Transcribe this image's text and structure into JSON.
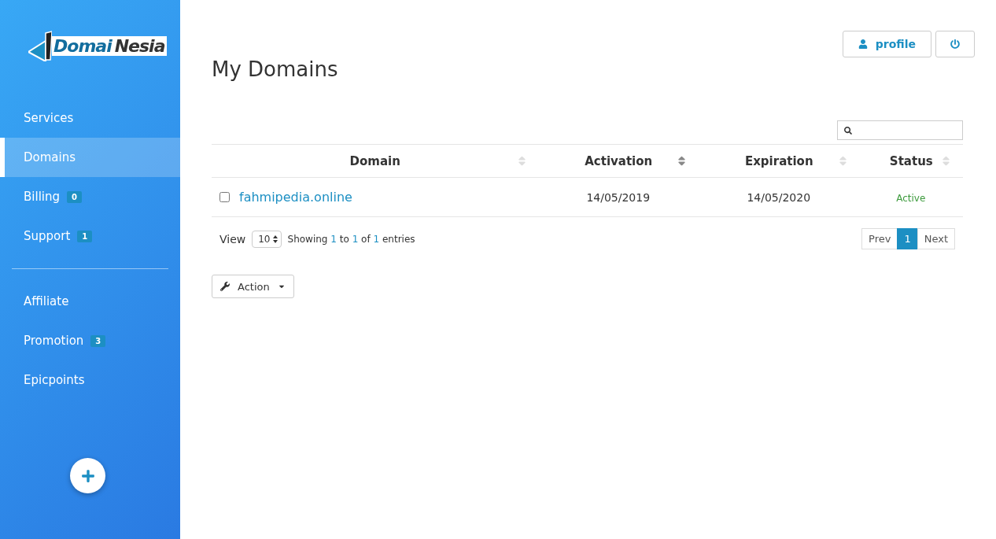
{
  "logo": {
    "parts": [
      "Domai",
      "Nesia"
    ]
  },
  "sidebar": {
    "groups": [
      {
        "items": [
          {
            "label": "Services",
            "selected": false
          },
          {
            "label": "Domains",
            "selected": true
          },
          {
            "label": "Billing",
            "selected": false,
            "badge": "0"
          },
          {
            "label": "Support",
            "selected": false,
            "badge": "1"
          }
        ]
      },
      {
        "items": [
          {
            "label": "Affiliate",
            "selected": false
          },
          {
            "label": "Promotion",
            "selected": false,
            "badge": "3"
          },
          {
            "label": "Epicpoints",
            "selected": false
          }
        ]
      }
    ]
  },
  "header": {
    "profile_button": "profile"
  },
  "page_title": "My Domains",
  "table": {
    "columns": [
      {
        "label": "Domain",
        "sorted": false
      },
      {
        "label": "Activation",
        "sorted": true
      },
      {
        "label": "Expiration",
        "sorted": false
      },
      {
        "label": "Status",
        "sorted": false
      }
    ],
    "rows": [
      {
        "checked": false,
        "domain": "fahmipedia.online",
        "activation": "14/05/2019",
        "expiration": "14/05/2020",
        "status": "Active",
        "color": "#3c9a3c"
      }
    ]
  },
  "footer": {
    "view_label": "View",
    "page_size": "10",
    "info": [
      "Showing",
      "1",
      "to",
      "1",
      "of",
      "1",
      "entries"
    ],
    "pagination": [
      {
        "label": "Prev",
        "selected": false
      },
      {
        "label": "1",
        "selected": true
      },
      {
        "label": "Next",
        "selected": false
      }
    ]
  },
  "action_button": "Action"
}
